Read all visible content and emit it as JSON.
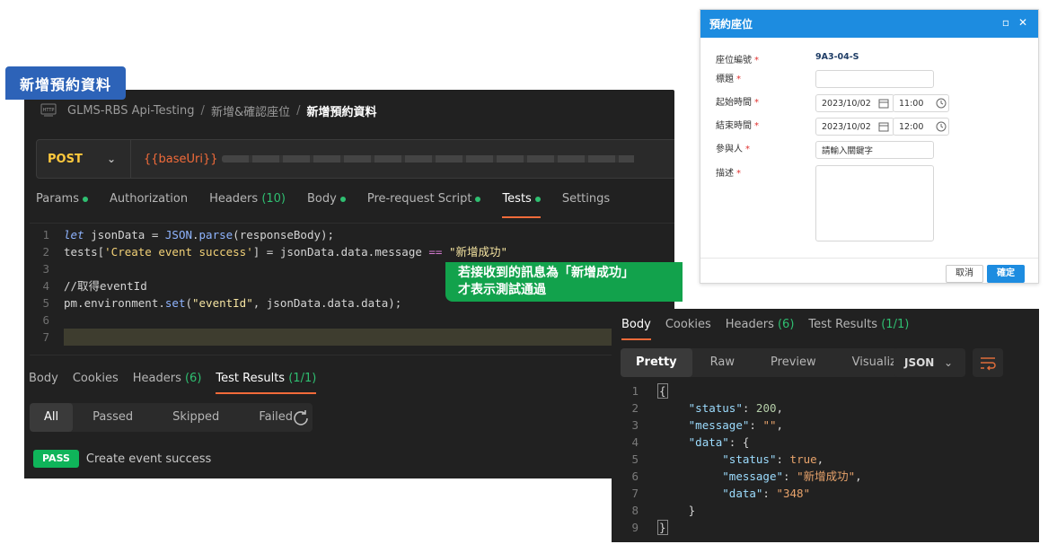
{
  "title_tag": "新增預約資料",
  "breadcrumb": {
    "collection": "GLMS-RBS Api-Testing",
    "folder": "新增&確認座位",
    "current": "新增預約資料",
    "separator": "/"
  },
  "request": {
    "method": "POST",
    "url_variable": "{{baseUri}}"
  },
  "request_tabs": [
    {
      "label": "Params",
      "dot": true
    },
    {
      "label": "Authorization",
      "dot": false
    },
    {
      "label": "Headers",
      "count": "(10)",
      "dot": false
    },
    {
      "label": "Body",
      "dot": true
    },
    {
      "label": "Pre-request Script",
      "dot": true
    },
    {
      "label": "Tests",
      "dot": true,
      "active": true
    },
    {
      "label": "Settings",
      "dot": false
    }
  ],
  "editor": {
    "line_numbers": [
      "1",
      "2",
      "3",
      "4",
      "5",
      "6",
      "7"
    ],
    "l1": {
      "kw": "let",
      "var": " jsonData = ",
      "obj": "JSON",
      "dot": ".",
      "fn": "parse",
      "rest": "(responseBody);"
    },
    "l2": {
      "pre": "tests[",
      "str": "'Create event success'",
      "mid": "] = jsonData.data.message ",
      "op": "==",
      "sp": " ",
      "str2": "\"新增成功\""
    },
    "l4": {
      "comment": "//取得eventId"
    },
    "l5": {
      "pre": "pm.environment.",
      "fn": "set",
      "open": "(",
      "str": "\"eventId\"",
      "rest": ", jsonData.data.data);"
    }
  },
  "callout": {
    "line1": "若接收到的訊息為「新增成功」",
    "line2": "才表示測試通過"
  },
  "response_tabs": [
    {
      "label": "Body"
    },
    {
      "label": "Cookies"
    },
    {
      "label": "Headers",
      "count": "(6)"
    },
    {
      "label": "Test Results",
      "count": "(1/1)",
      "active": true
    }
  ],
  "filters": [
    "All",
    "Passed",
    "Skipped",
    "Failed"
  ],
  "test_result": {
    "badge": "PASS",
    "name": "Create event success"
  },
  "dialog": {
    "title": "預約座位",
    "fields": {
      "seat_label": "座位編號",
      "seat_value": "9A3-04-S",
      "subject_label": "標題",
      "start_label": "起始時間",
      "start_date": "2023/10/02",
      "start_time": "11:00",
      "end_label": "結束時間",
      "end_date": "2023/10/02",
      "end_time": "12:00",
      "participant_label": "參與人",
      "participant_placeholder": "請輸入關鍵字",
      "desc_label": "描述",
      "required_mark": "*"
    },
    "cancel": "取消",
    "ok": "確定"
  },
  "response": {
    "tabs": [
      {
        "label": "Body",
        "active": true
      },
      {
        "label": "Cookies"
      },
      {
        "label": "Headers",
        "count": "(6)"
      },
      {
        "label": "Test Results",
        "count": "(1/1)"
      }
    ],
    "views": [
      "Pretty",
      "Raw",
      "Preview",
      "Visualize"
    ],
    "format": "JSON",
    "line_numbers": [
      "1",
      "2",
      "3",
      "4",
      "5",
      "6",
      "7",
      "8",
      "9"
    ],
    "json": {
      "open": "{",
      "close": "}",
      "status_key": "\"status\"",
      "status_val": "200",
      "message_key": "\"message\"",
      "message_val": "\"\"",
      "data_key": "\"data\"",
      "inner_status_key": "\"status\"",
      "inner_status_val": "true",
      "inner_message_key": "\"message\"",
      "inner_message_val": "\"新增成功\"",
      "inner_data_key": "\"data\"",
      "inner_data_val": "\"348\""
    }
  },
  "colors": {
    "accent_orange": "#f26b3a",
    "pass_green": "#0fb45a",
    "callout_green": "#12a24c",
    "tag_blue": "#2d63b8",
    "dialog_blue": "#1d8ce0",
    "method_yellow": "#ffc93d"
  }
}
